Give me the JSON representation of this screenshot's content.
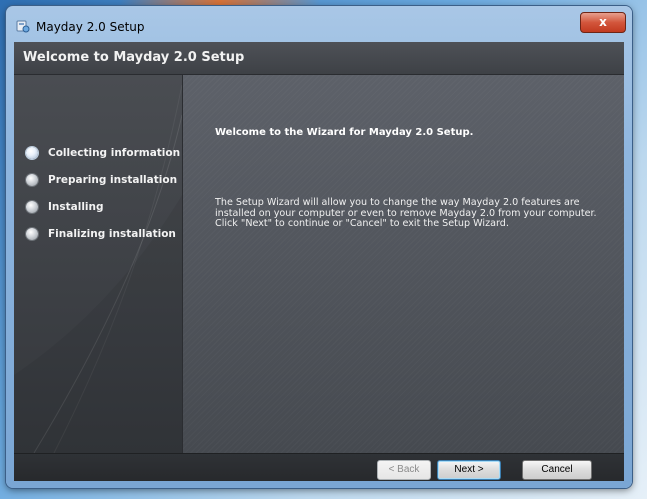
{
  "window": {
    "title": "Mayday 2.0 Setup",
    "close_label": "x",
    "app_icon": "installer-icon"
  },
  "header": {
    "title": "Welcome to Mayday 2.0 Setup"
  },
  "steps": [
    {
      "label": "Collecting information",
      "state": "active"
    },
    {
      "label": "Preparing installation",
      "state": "pending"
    },
    {
      "label": "Installing",
      "state": "pending"
    },
    {
      "label": "Finalizing installation",
      "state": "pending"
    }
  ],
  "content": {
    "heading": "Welcome to the Wizard for Mayday 2.0 Setup.",
    "description": "The Setup Wizard will allow you to change the way Mayday 2.0 features are installed on your computer or even to remove Mayday 2.0 from your computer. Click \"Next\" to continue or \"Cancel\" to exit the Setup Wizard."
  },
  "buttons": {
    "back": "< Back",
    "next": "Next >",
    "cancel": "Cancel"
  },
  "colors": {
    "header_bg": "#45484d",
    "content_bg": "#55595f",
    "close_red": "#d3563c"
  }
}
